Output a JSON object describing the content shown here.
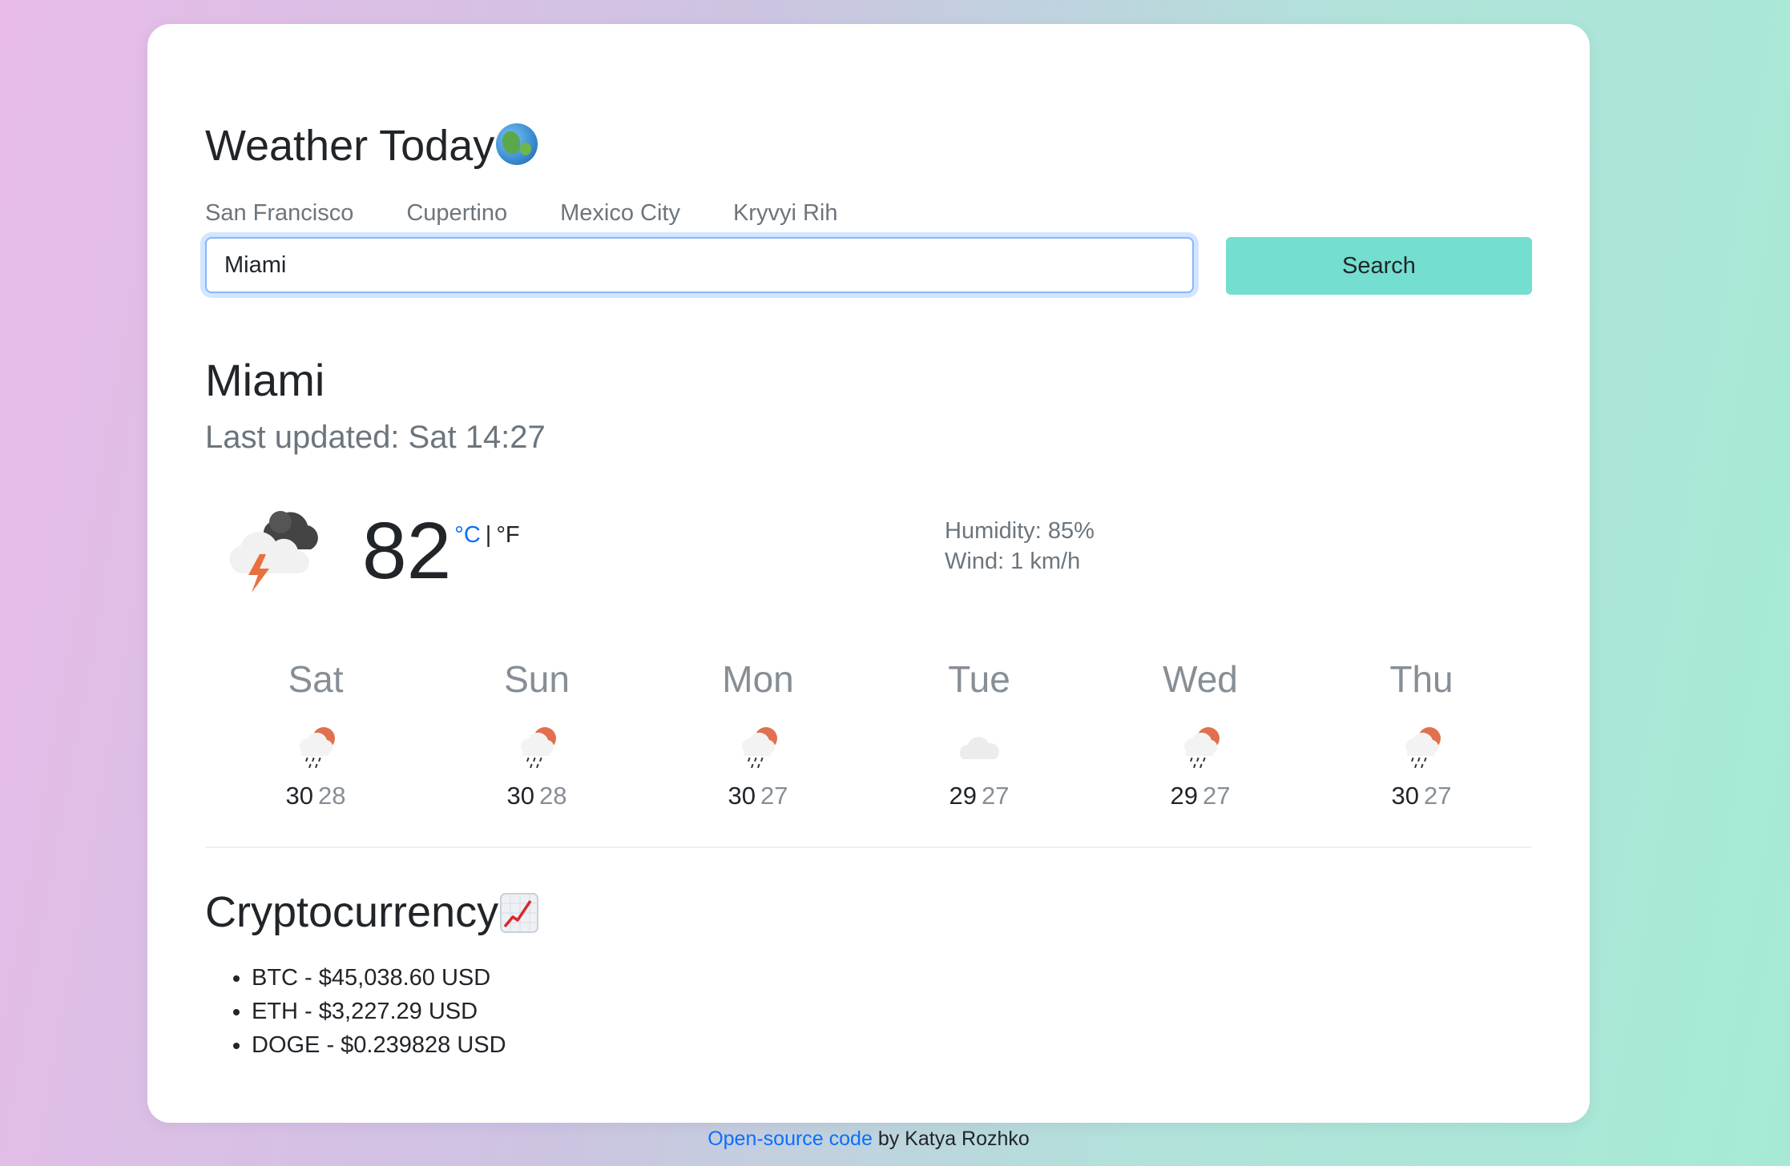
{
  "app": {
    "title": "Weather Today",
    "title_icon": "globe-icon"
  },
  "city_links": [
    "San Francisco",
    "Cupertino",
    "Mexico City",
    "Kryvyi Rih"
  ],
  "search": {
    "value": "Miami",
    "button_label": "Search"
  },
  "current": {
    "city": "Miami",
    "last_updated": "Last updated: Sat 14:27",
    "icon": "thunderstorm-icon",
    "temperature": "82",
    "unit_celsius": "°C",
    "unit_separator": "|",
    "unit_fahrenheit": "°F",
    "humidity": "Humidity: 85%",
    "wind": "Wind: 1 km/h"
  },
  "forecast": [
    {
      "day": "Sat",
      "icon": "rain-sun-icon",
      "max": "30",
      "min": "28"
    },
    {
      "day": "Sun",
      "icon": "rain-sun-icon",
      "max": "30",
      "min": "28"
    },
    {
      "day": "Mon",
      "icon": "rain-sun-icon",
      "max": "30",
      "min": "27"
    },
    {
      "day": "Tue",
      "icon": "cloud-icon",
      "max": "29",
      "min": "27"
    },
    {
      "day": "Wed",
      "icon": "rain-sun-icon",
      "max": "29",
      "min": "27"
    },
    {
      "day": "Thu",
      "icon": "rain-sun-icon",
      "max": "30",
      "min": "27"
    }
  ],
  "crypto": {
    "title": "Cryptocurrency",
    "title_icon": "chart-increasing-icon",
    "items": [
      "BTC - $45,038.60 USD",
      "ETH - $3,227.29 USD",
      "DOGE - $0.239828 USD"
    ]
  },
  "footer": {
    "link_text": "Open-source code",
    "text": " by Katya Rozhko"
  },
  "colors": {
    "accent_button": "#74ded0",
    "link": "#0d6efd",
    "muted": "#6c757d"
  }
}
